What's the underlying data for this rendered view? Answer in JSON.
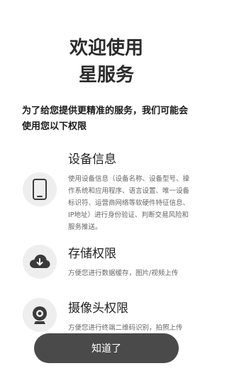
{
  "header": {
    "title_line1": "欢迎使用",
    "title_line2": "星服务"
  },
  "intro_text": "为了给您提供更精准的服务，我们可能会使用您以下权限",
  "permissions": [
    {
      "icon": "phone-icon",
      "title": "设备信息",
      "description": "使用设备信息（设备名称、设备型号、操作系统和应用程序、语言设置、唯一设备标识符、运营商网络等软硬件特征信息、IP地址）进行身份验证、判断交易风险和服务推送。"
    },
    {
      "icon": "cloud-download-icon",
      "title": "存储权限",
      "description": "方便您进行数据缓存，图片/视频上传"
    },
    {
      "icon": "camera-icon",
      "title": "摄像头权限",
      "description": "方便您进行终端二维码识别，拍照上传"
    }
  ],
  "confirm_button": "知道了",
  "colors": {
    "button_bg": "#4a4a4a",
    "icon_bg": "#eeeeee",
    "icon_fg": "#3a3a3a"
  }
}
